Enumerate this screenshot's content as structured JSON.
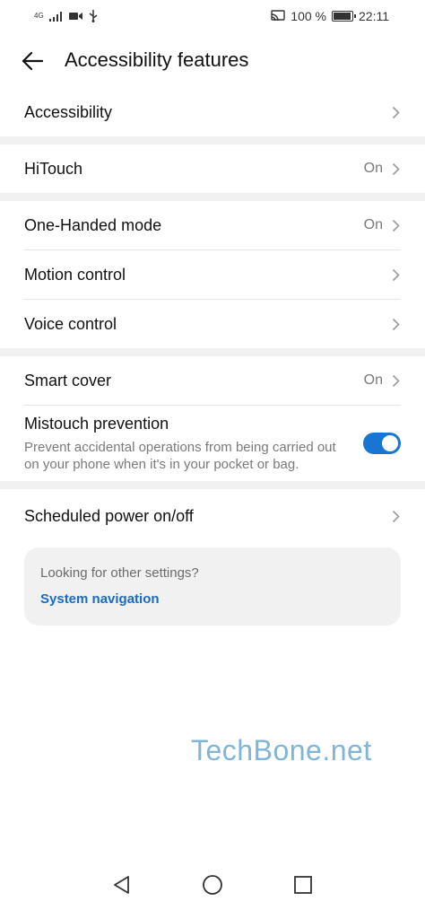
{
  "status": {
    "network": "4G",
    "battery_text": "100 %",
    "battery_level": 1.0,
    "time": "22:11"
  },
  "header": {
    "title": "Accessibility features"
  },
  "items": {
    "accessibility": {
      "label": "Accessibility"
    },
    "hitouch": {
      "label": "HiTouch",
      "value": "On"
    },
    "one_handed": {
      "label": "One-Handed mode",
      "value": "On"
    },
    "motion_control": {
      "label": "Motion control"
    },
    "voice_control": {
      "label": "Voice control"
    },
    "smart_cover": {
      "label": "Smart cover",
      "value": "On"
    },
    "mistouch": {
      "label": "Mistouch prevention",
      "description": "Prevent accidental operations from being carried out on your phone when it's in your pocket or bag.",
      "enabled": true
    },
    "scheduled_power": {
      "label": "Scheduled power on/off"
    }
  },
  "suggestion": {
    "question": "Looking for other settings?",
    "link": "System navigation"
  },
  "watermark": "TechBone.net",
  "colors": {
    "accent": "#1876d2",
    "link": "#1a6bc2",
    "watermark": "#7fb6d8"
  }
}
